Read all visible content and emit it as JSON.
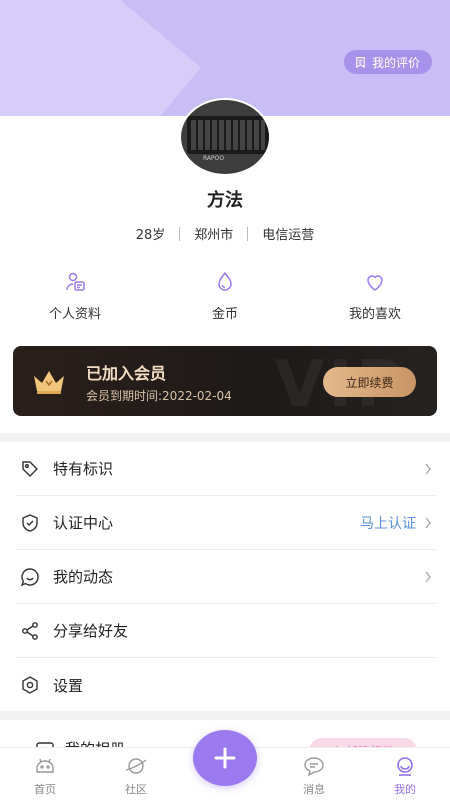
{
  "header": {
    "review_label": "我的评价"
  },
  "profile": {
    "name": "方法",
    "age": "28岁",
    "city": "郑州市",
    "job": "电信运营",
    "avatar_brand": "RAPOO"
  },
  "quick_actions": [
    {
      "label": "个人资料",
      "icon": "profile-card-icon"
    },
    {
      "label": "金币",
      "icon": "coin-drop-icon"
    },
    {
      "label": "我的喜欢",
      "icon": "heart-icon"
    }
  ],
  "vip": {
    "title": "已加入会员",
    "expire_text": "会员到期时间:2022-02-04",
    "renew_label": "立即续费",
    "watermark": "VIP"
  },
  "menu": [
    {
      "label": "特有标识",
      "icon": "tag-icon",
      "action": ""
    },
    {
      "label": "认证中心",
      "icon": "shield-check-icon",
      "action": "马上认证"
    },
    {
      "label": "我的动态",
      "icon": "chat-smile-icon",
      "action": ""
    },
    {
      "label": "分享给好友",
      "icon": "share-icon",
      "action": ""
    },
    {
      "label": "设置",
      "icon": "settings-hexagon-icon",
      "action": ""
    }
  ],
  "peek": {
    "label": "我的相册",
    "pill_label": "新建相册"
  },
  "tabbar": {
    "tabs": [
      {
        "label": "首页",
        "icon": "home-mascot-icon"
      },
      {
        "label": "社区",
        "icon": "planet-icon"
      },
      {
        "label": "消息",
        "icon": "message-bubble-icon"
      },
      {
        "label": "我的",
        "icon": "profile-mascot-icon"
      }
    ],
    "active_index": 3
  },
  "colors": {
    "accent": "#9b7af0",
    "header_bg": "#c9bdf6",
    "vip_gold": "#f3ddc4",
    "action_blue": "#5a8ed8"
  }
}
